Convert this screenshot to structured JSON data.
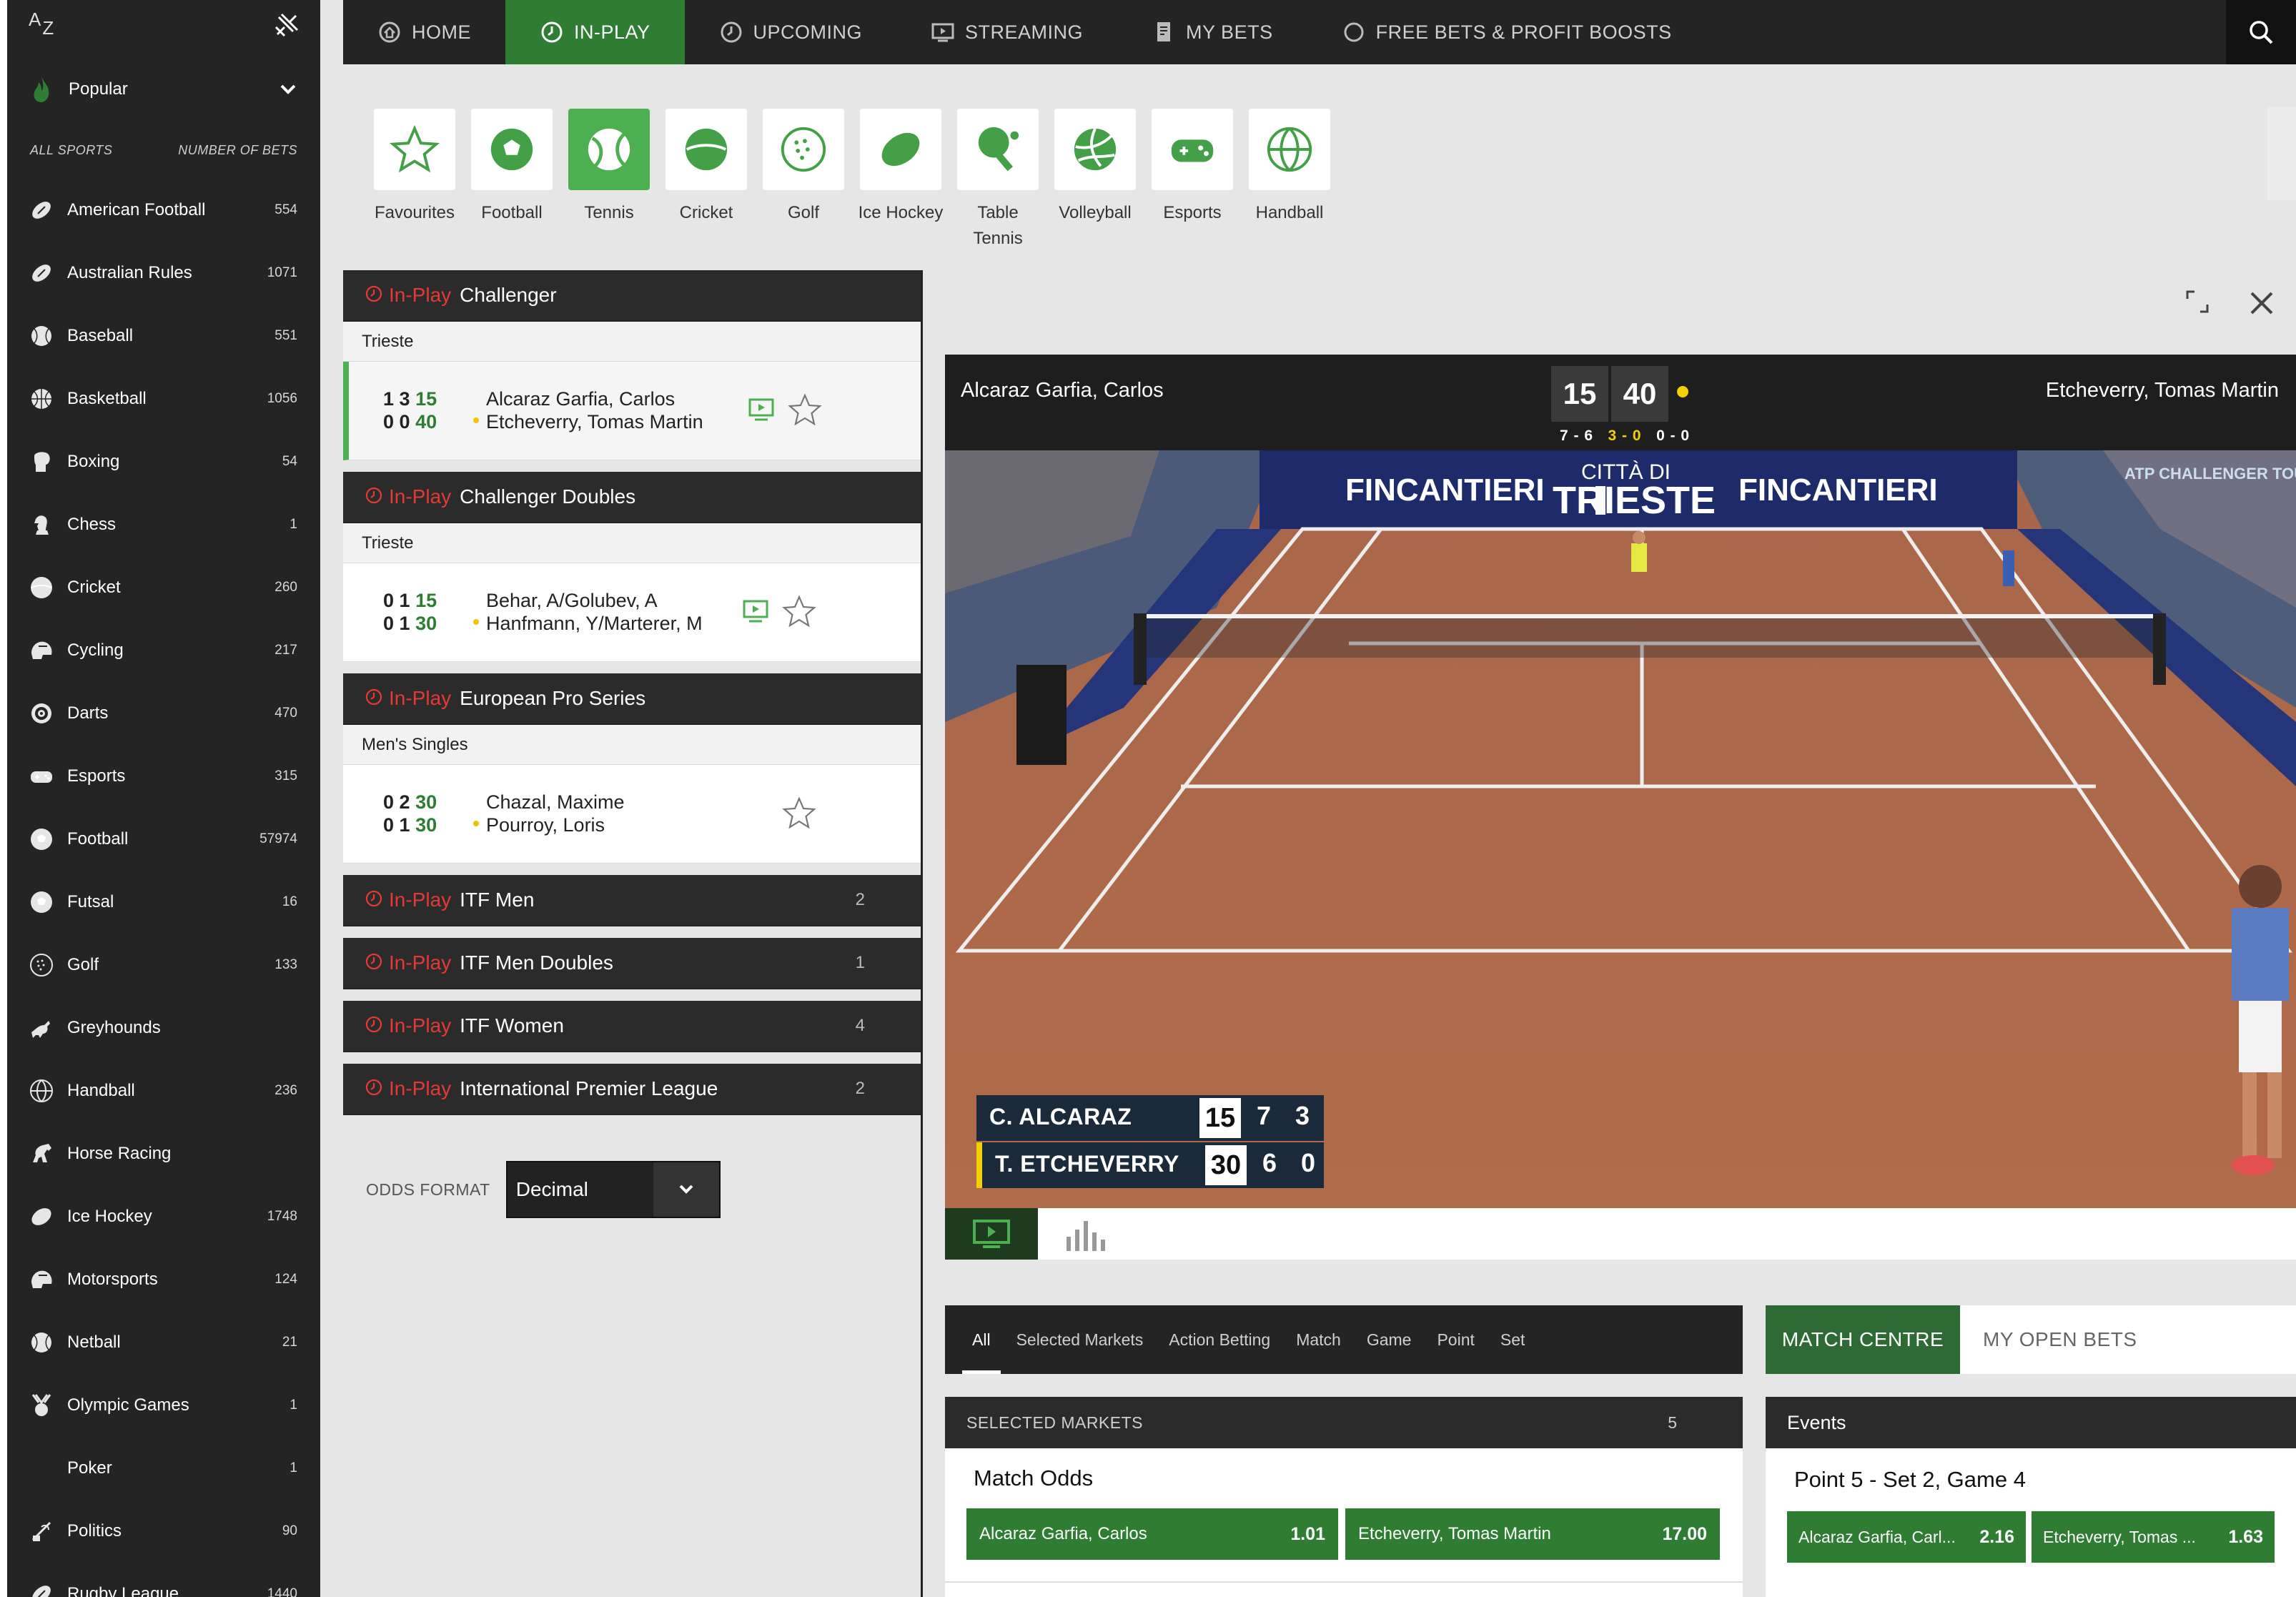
{
  "sidebar": {
    "az_a": "A",
    "az_z": "Z",
    "popular": "Popular",
    "col_sports": "ALL SPORTS",
    "col_bets": "NUMBER OF BETS",
    "items": [
      {
        "name": "American Football",
        "count": "554",
        "icon": "american-football-icon"
      },
      {
        "name": "Australian Rules",
        "count": "1071",
        "icon": "australian-rules-icon"
      },
      {
        "name": "Baseball",
        "count": "551",
        "icon": "baseball-icon"
      },
      {
        "name": "Basketball",
        "count": "1056",
        "icon": "basketball-icon"
      },
      {
        "name": "Boxing",
        "count": "54",
        "icon": "boxing-glove-icon"
      },
      {
        "name": "Chess",
        "count": "1",
        "icon": "chess-knight-icon"
      },
      {
        "name": "Cricket",
        "count": "260",
        "icon": "cricket-ball-icon"
      },
      {
        "name": "Cycling",
        "count": "217",
        "icon": "cycling-helmet-icon"
      },
      {
        "name": "Darts",
        "count": "470",
        "icon": "dartboard-icon"
      },
      {
        "name": "Esports",
        "count": "315",
        "icon": "gamepad-icon"
      },
      {
        "name": "Football",
        "count": "57974",
        "icon": "football-icon"
      },
      {
        "name": "Futsal",
        "count": "16",
        "icon": "futsal-icon"
      },
      {
        "name": "Golf",
        "count": "133",
        "icon": "golf-ball-icon"
      },
      {
        "name": "Greyhounds",
        "count": "",
        "icon": "greyhound-icon"
      },
      {
        "name": "Handball",
        "count": "236",
        "icon": "handball-icon"
      },
      {
        "name": "Horse Racing",
        "count": "",
        "icon": "horse-icon"
      },
      {
        "name": "Ice Hockey",
        "count": "1748",
        "icon": "ice-hockey-puck-icon"
      },
      {
        "name": "Motorsports",
        "count": "124",
        "icon": "helmet-icon"
      },
      {
        "name": "Netball",
        "count": "21",
        "icon": "netball-icon"
      },
      {
        "name": "Olympic Games",
        "count": "1",
        "icon": "medal-icon"
      },
      {
        "name": "Poker",
        "count": "1",
        "icon": ""
      },
      {
        "name": "Politics",
        "count": "90",
        "icon": "podium-icon"
      },
      {
        "name": "Rugby League",
        "count": "1440",
        "icon": "rugby-ball-icon"
      }
    ]
  },
  "topnav": {
    "tabs": [
      {
        "label": "HOME",
        "icon": "home-icon"
      },
      {
        "label": "IN-PLAY",
        "icon": "clock-icon"
      },
      {
        "label": "UPCOMING",
        "icon": "clock-icon"
      },
      {
        "label": "STREAMING",
        "icon": "tv-icon"
      },
      {
        "label": "MY BETS",
        "icon": "bet-slip-icon"
      },
      {
        "label": "FREE BETS & PROFIT BOOSTS",
        "icon": "circle-icon"
      }
    ],
    "active": "IN-PLAY"
  },
  "sports": [
    {
      "label": "Favourites",
      "icon": "star-icon"
    },
    {
      "label": "Football",
      "icon": "football-icon"
    },
    {
      "label": "Tennis",
      "icon": "tennis-ball-icon"
    },
    {
      "label": "Cricket",
      "icon": "cricket-ball-icon"
    },
    {
      "label": "Golf",
      "icon": "golf-ball-icon"
    },
    {
      "label": "Ice Hockey",
      "icon": "ice-hockey-puck-icon"
    },
    {
      "label": "Table Tennis",
      "icon": "table-tennis-icon"
    },
    {
      "label": "Volleyball",
      "icon": "volleyball-icon"
    },
    {
      "label": "Esports",
      "icon": "gamepad-icon"
    },
    {
      "label": "Handball",
      "icon": "handball-icon"
    }
  ],
  "events": {
    "inplay_label": "In-Play",
    "groups": [
      {
        "title": "Challenger",
        "sub": "Trieste",
        "match": {
          "s1": "1 3",
          "p1": "15",
          "s2": "0 0",
          "p2": "40",
          "n1": "Alcaraz Garfia, Carlos",
          "n2": "Etcheverry, Tomas Martin"
        }
      },
      {
        "title": "Challenger Doubles",
        "sub": "Trieste",
        "match": {
          "s1": "0 1",
          "p1": "15",
          "s2": "0 1",
          "p2": "30",
          "n1": "Behar, A/Golubev, A",
          "n2": "Hanfmann, Y/Marterer, M"
        }
      },
      {
        "title": "European Pro Series",
        "sub": "Men's Singles",
        "match": {
          "s1": "0 2",
          "p1": "30",
          "s2": "0 1",
          "p2": "30",
          "n1": "Chazal, Maxime",
          "n2": "Pourroy, Loris"
        }
      },
      {
        "title": "ITF Men",
        "count": "2"
      },
      {
        "title": "ITF Men Doubles",
        "count": "1"
      },
      {
        "title": "ITF Women",
        "count": "4"
      },
      {
        "title": "International Premier League",
        "count": "2"
      }
    ]
  },
  "odds_format": {
    "label": "ODDS FORMAT",
    "value": "Decimal"
  },
  "scoreboard": {
    "player1": "Alcaraz Garfia, Carlos",
    "player2": "Etcheverry, Tomas Martin",
    "point1": "15",
    "point2": "40",
    "set1": "7 - 6",
    "set2": "3 - 0",
    "set3": "0 - 0"
  },
  "video_overlay": {
    "p1": {
      "name": "C. ALCARAZ",
      "pt": "15",
      "s1": "7",
      "s2": "3"
    },
    "p2": {
      "name": "T. ETCHEVERRY",
      "pt": "30",
      "s1": "6",
      "s2": "0"
    },
    "banners": [
      "FINCANTIERI",
      "CITTÀ DI",
      "TRIESTE",
      "FINCANTIERI",
      "ATP CHALLENGER TOUR"
    ]
  },
  "markets": {
    "tabs": [
      "All",
      "Selected Markets",
      "Action Betting",
      "Match",
      "Game",
      "Point",
      "Set"
    ],
    "active": "All",
    "header": "SELECTED MARKETS",
    "header_count": "5",
    "title": "Match Odds",
    "odds": [
      {
        "name": "Alcaraz Garfia, Carlos",
        "price": "1.01"
      },
      {
        "name": "Etcheverry, Tomas Martin",
        "price": "17.00"
      }
    ]
  },
  "match_centre": {
    "tab1": "MATCH CENTRE",
    "tab2": "MY OPEN BETS",
    "events_header": "Events",
    "title": "Point 5 - Set 2, Game 4",
    "odds": [
      {
        "name": "Alcaraz Garfia, Carl...",
        "price": "2.16"
      },
      {
        "name": "Etcheverry, Tomas ...",
        "price": "1.63"
      }
    ]
  },
  "colors": {
    "accent": "#2e7d32",
    "live_red": "#e53935",
    "dark": "#242424",
    "serve_yellow": "#f4d000"
  }
}
